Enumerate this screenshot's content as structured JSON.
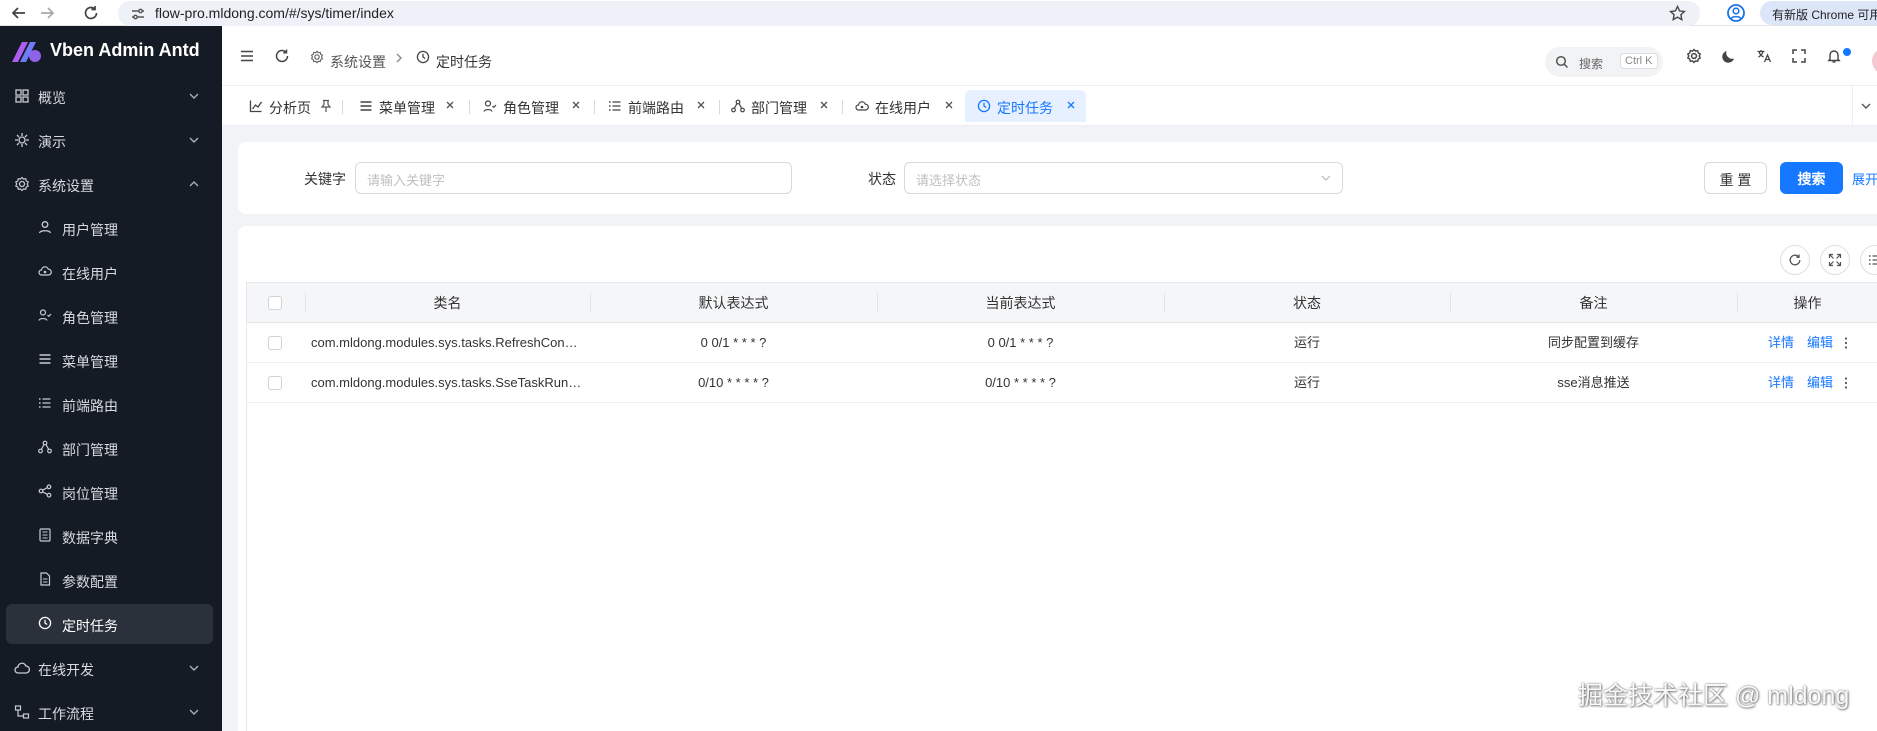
{
  "browser": {
    "url": "flow-pro.mldong.com/#/sys/timer/index",
    "update_chip": "有新版 Chrome 可用"
  },
  "app": {
    "title": "Vben Admin Antd"
  },
  "sidebar": {
    "items": [
      {
        "label": "概览",
        "icon": "dashboard-icon",
        "level": "top",
        "expanded": false
      },
      {
        "label": "演示",
        "icon": "demo-icon",
        "level": "top",
        "expanded": false
      },
      {
        "label": "系统设置",
        "icon": "settings-icon",
        "level": "top",
        "expanded": true
      },
      {
        "label": "用户管理",
        "icon": "user-icon",
        "level": "sub"
      },
      {
        "label": "在线用户",
        "icon": "cloud-user-icon",
        "level": "sub"
      },
      {
        "label": "角色管理",
        "icon": "role-icon",
        "level": "sub"
      },
      {
        "label": "菜单管理",
        "icon": "menu-icon",
        "level": "sub"
      },
      {
        "label": "前端路由",
        "icon": "list-icon",
        "level": "sub"
      },
      {
        "label": "部门管理",
        "icon": "org-icon",
        "level": "sub"
      },
      {
        "label": "岗位管理",
        "icon": "share-icon",
        "level": "sub"
      },
      {
        "label": "数据字典",
        "icon": "book-icon",
        "level": "sub"
      },
      {
        "label": "参数配置",
        "icon": "doc-icon",
        "level": "sub"
      },
      {
        "label": "定时任务",
        "icon": "clock-icon",
        "level": "sub",
        "active": true
      },
      {
        "label": "在线开发",
        "icon": "cloud-icon",
        "level": "top",
        "expanded": false
      },
      {
        "label": "工作流程",
        "icon": "flow-icon",
        "level": "top",
        "expanded": false
      }
    ]
  },
  "header": {
    "breadcrumb": [
      "系统设置",
      "定时任务"
    ],
    "search_label": "搜索",
    "search_shortcut": "Ctrl K"
  },
  "tabs": [
    {
      "label": "分析页",
      "icon": "chart-icon",
      "pinned": true
    },
    {
      "label": "菜单管理",
      "icon": "menu-icon"
    },
    {
      "label": "角色管理",
      "icon": "role-icon"
    },
    {
      "label": "前端路由",
      "icon": "list-icon"
    },
    {
      "label": "部门管理",
      "icon": "org-icon"
    },
    {
      "label": "在线用户",
      "icon": "cloud-user-icon"
    },
    {
      "label": "定时任务",
      "icon": "clock-icon",
      "active": true
    }
  ],
  "form": {
    "keyword_label": "关键字",
    "keyword_placeholder": "请输入关键字",
    "status_label": "状态",
    "status_placeholder": "请选择状态",
    "reset_label": "重 置",
    "search_label": "搜索",
    "expand_label": "展开"
  },
  "table": {
    "columns": [
      "类名",
      "默认表达式",
      "当前表达式",
      "状态",
      "备注",
      "操作"
    ],
    "rows": [
      {
        "class_name": "com.mldong.modules.sys.tasks.RefreshConsta...",
        "default_expr": "0 0/1 * * * ?",
        "current_expr": "0 0/1 * * * ?",
        "status": "运行",
        "remark": "同步配置到缓存",
        "action_detail": "详情",
        "action_edit": "编辑"
      },
      {
        "class_name": "com.mldong.modules.sys.tasks.SseTaskRunner",
        "default_expr": "0/10 * * * * ?",
        "current_expr": "0/10 * * * * ?",
        "status": "运行",
        "remark": "sse消息推送",
        "action_detail": "详情",
        "action_edit": "编辑"
      }
    ]
  },
  "watermark": "掘金技术社区 @ mldong",
  "colors": {
    "primary": "#1677ff",
    "sidebar_bg": "#151b24",
    "sidebar_active_bg": "#2b313b",
    "active_tab_bg": "#e6f0ff"
  }
}
